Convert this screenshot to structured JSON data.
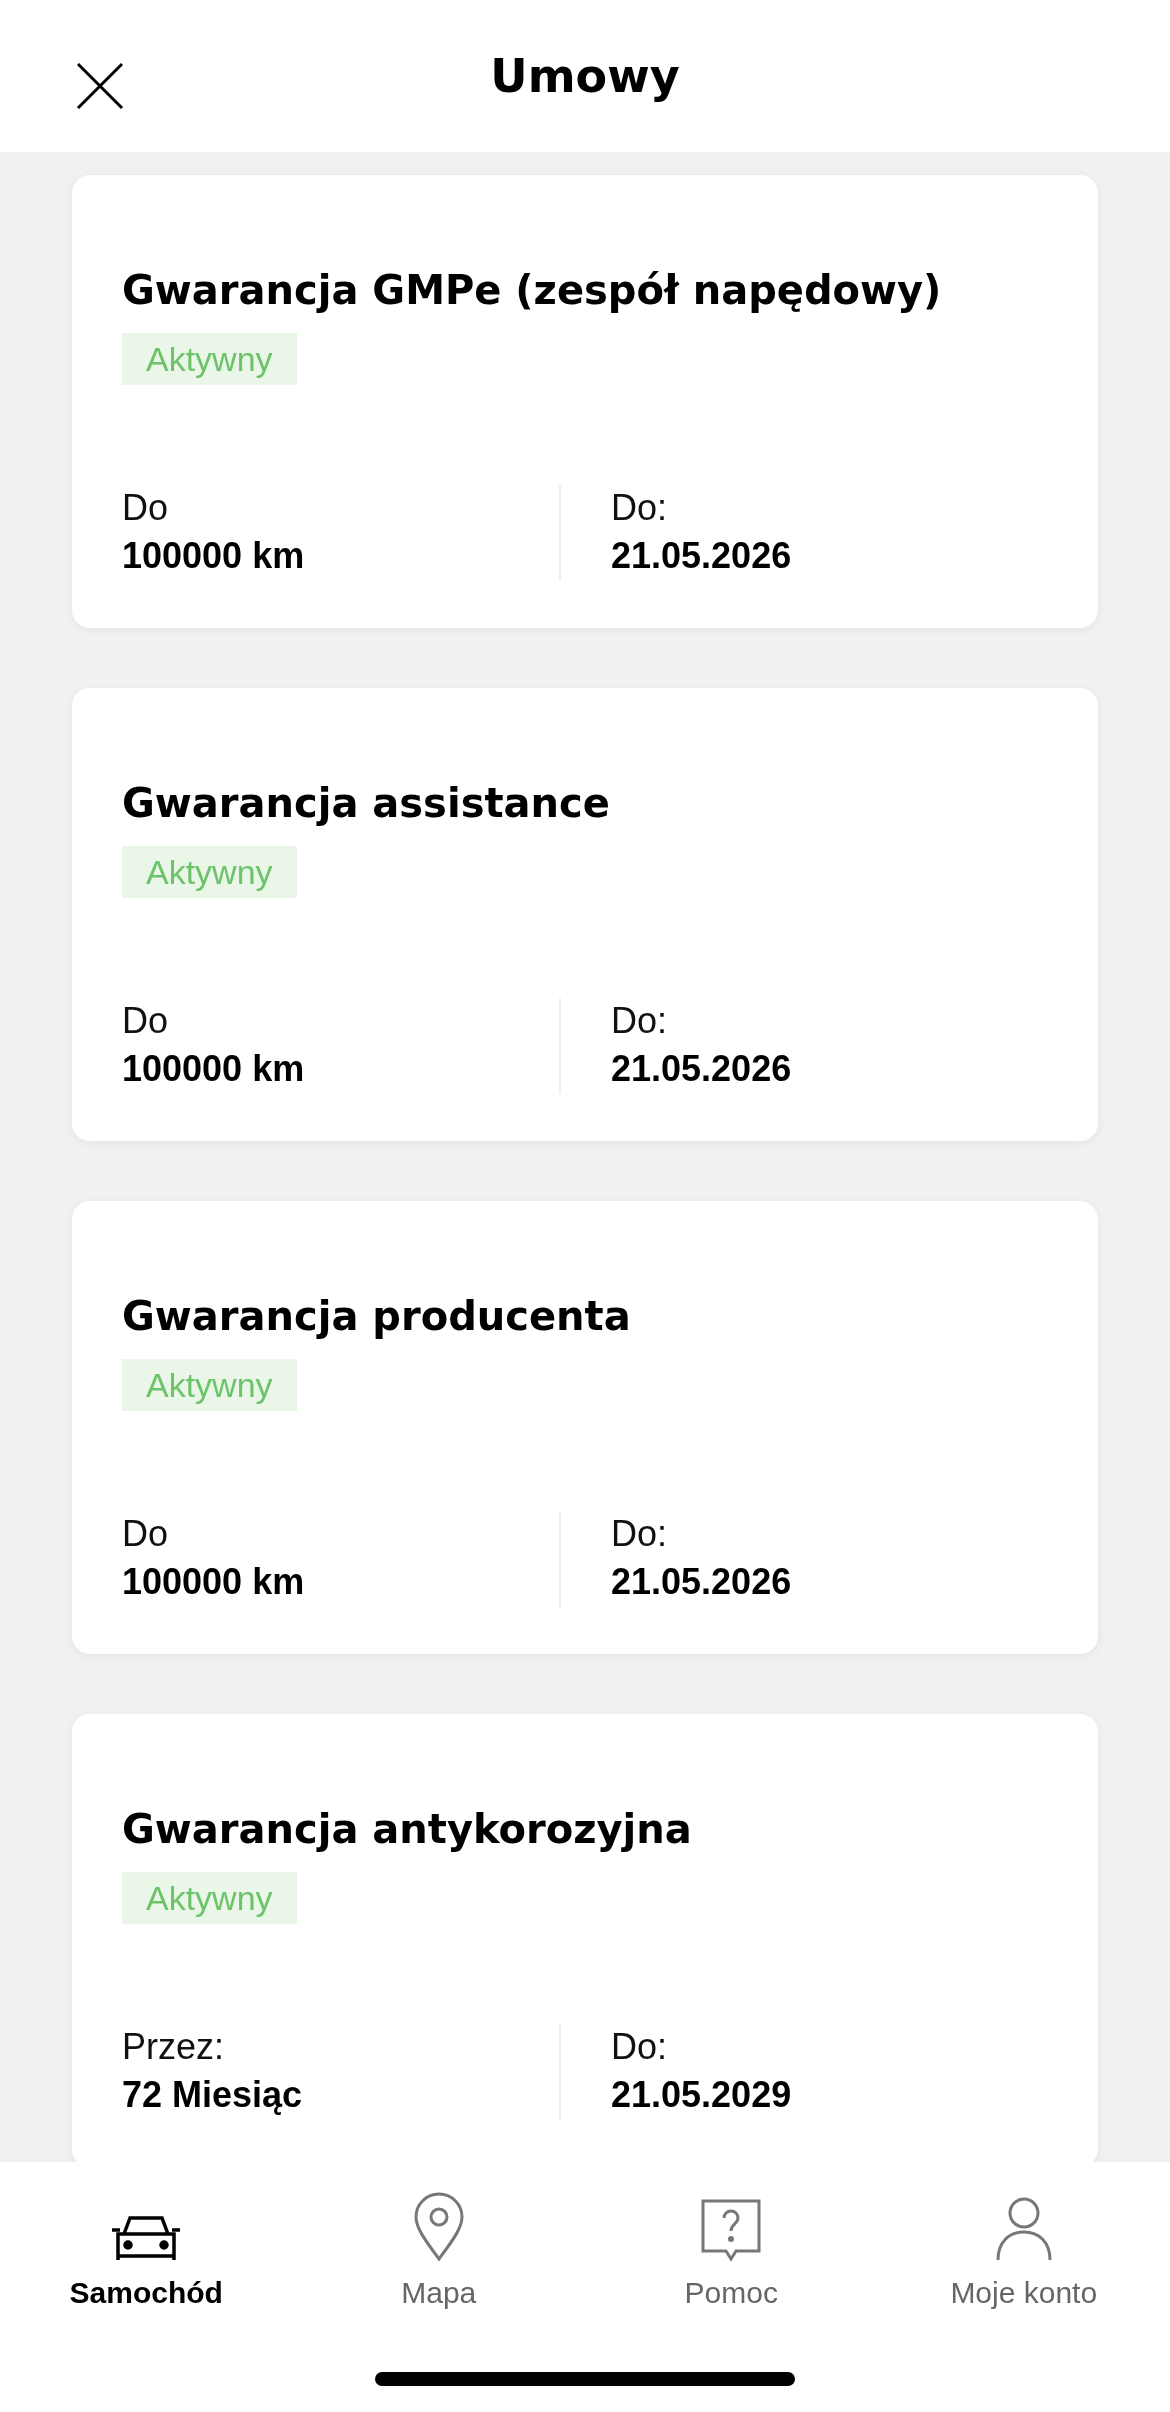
{
  "header": {
    "title": "Umowy"
  },
  "contracts": [
    {
      "title": "Gwarancja GMPe (zespół napędowy)",
      "status": "Aktywny",
      "limit_label": "Do",
      "limit_value": "100000 km",
      "date_label": "Do:",
      "date_value": "21.05.2026"
    },
    {
      "title": "Gwarancja assistance",
      "status": "Aktywny",
      "limit_label": "Do",
      "limit_value": "100000 km",
      "date_label": "Do:",
      "date_value": "21.05.2026"
    },
    {
      "title": "Gwarancja producenta",
      "status": "Aktywny",
      "limit_label": "Do",
      "limit_value": "100000 km",
      "date_label": "Do:",
      "date_value": "21.05.2026"
    },
    {
      "title": "Gwarancja antykorozyjna",
      "status": "Aktywny",
      "limit_label": "Przez:",
      "limit_value": "72 Miesiąc",
      "date_label": "Do:",
      "date_value": "21.05.2029"
    }
  ],
  "nav": [
    {
      "label": "Samochód",
      "selected": true
    },
    {
      "label": "Mapa",
      "selected": false
    },
    {
      "label": "Pomoc",
      "selected": false
    },
    {
      "label": "Moje konto",
      "selected": false
    }
  ]
}
